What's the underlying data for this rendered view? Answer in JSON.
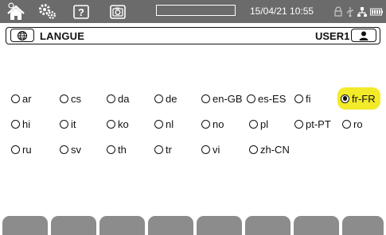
{
  "status_bar": {
    "datetime": "15/04/21 10:55",
    "progress_fraction": 0.0,
    "icons": [
      "home-icon",
      "settings-gear-icon",
      "help-icon",
      "camera-icon",
      "lock-icon",
      "usb-icon",
      "network-icon",
      "battery-icon"
    ]
  },
  "title_bar": {
    "title": "LANGUE",
    "user": "USER1",
    "left_icon": "globe-icon",
    "right_icon": "user-icon"
  },
  "languages": {
    "row1": [
      "ar",
      "cs",
      "da",
      "de",
      "en-GB",
      "es-ES",
      "fi",
      "fr-FR"
    ],
    "row2": [
      "hi",
      "it",
      "ko",
      "nl",
      "no",
      "pl",
      "pt-PT",
      "ro"
    ],
    "row3": [
      "ru",
      "sv",
      "th",
      "tr",
      "vi",
      "zh-CN"
    ],
    "selected": "fr-FR"
  },
  "colors": {
    "toolbar": "#6b6b6b",
    "selected_highlight": "#f3ea2a",
    "softkey": "#8c8c8c"
  }
}
